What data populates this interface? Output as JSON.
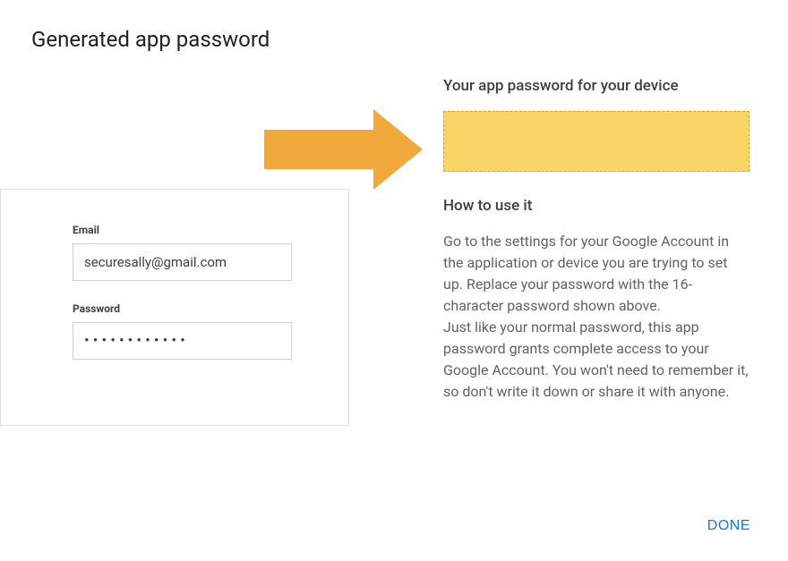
{
  "title": "Generated app password",
  "left": {
    "email_label": "Email",
    "email_value": "securesally@gmail.com",
    "password_label": "Password",
    "password_masked": "••••••••••••"
  },
  "right": {
    "subtitle": "Your app password for your device",
    "how_to_title": "How to use it",
    "body_p1": "Go to the settings for your Google Account in the application or device you are trying to set up. Replace your password with the 16-character password shown above.",
    "body_p2": "Just like your normal password, this app password grants complete access to your Google Account. You won't need to remember it, so don't write it down or share it with anyone."
  },
  "done_label": "DONE"
}
